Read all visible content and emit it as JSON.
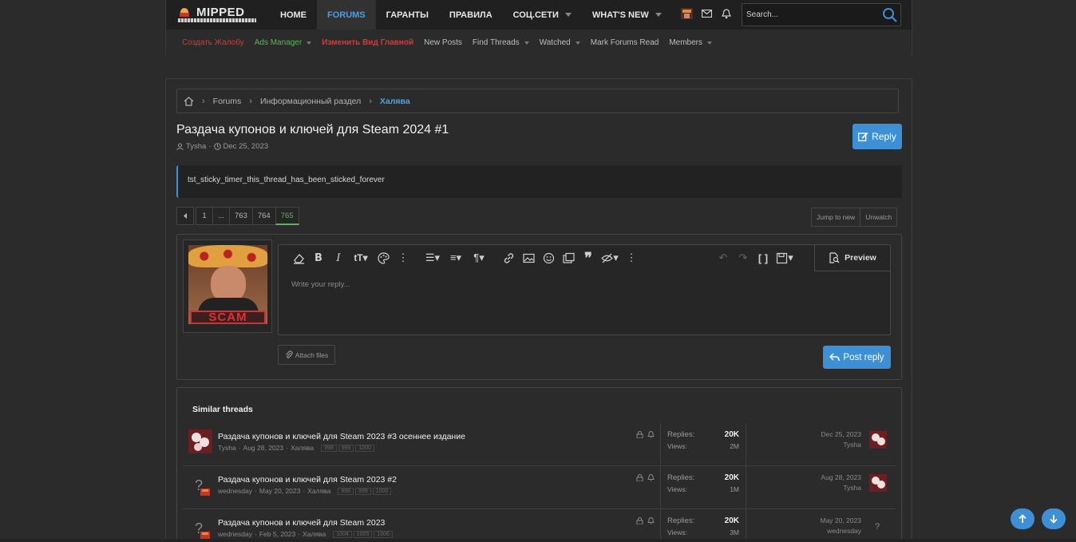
{
  "header": {
    "logo_text": "MIPPED",
    "nav": [
      {
        "label": "HOME",
        "active": false,
        "caret": false
      },
      {
        "label": "FORUMS",
        "active": true,
        "caret": false
      },
      {
        "label": "ГАРАНТЫ",
        "active": false,
        "caret": false
      },
      {
        "label": "ПРАВИЛА",
        "active": false,
        "caret": false
      },
      {
        "label": "СОЦ.СЕТИ",
        "active": false,
        "caret": true
      },
      {
        "label": "WHAT'S NEW",
        "active": false,
        "caret": true
      }
    ],
    "search_placeholder": "Search..."
  },
  "subnav": [
    {
      "label": "Создать Жалобу",
      "color": "#d23a3a",
      "caret": false
    },
    {
      "label": "Ads Manager",
      "color": "#4bbf4b",
      "caret": true
    },
    {
      "label": "Изменить Вид Главной",
      "color": "#e03535",
      "caret": false
    },
    {
      "label": "New Posts",
      "color": "#bdbdbd",
      "caret": false
    },
    {
      "label": "Find Threads",
      "color": "#bdbdbd",
      "caret": true
    },
    {
      "label": "Watched",
      "color": "#bdbdbd",
      "caret": true
    },
    {
      "label": "Mark Forums Read",
      "color": "#bdbdbd",
      "caret": false
    },
    {
      "label": "Members",
      "color": "#bdbdbd",
      "caret": true
    }
  ],
  "breadcrumbs": [
    "Forums",
    "Информационный раздел",
    "Халява"
  ],
  "thread": {
    "title": "Раздача купонов и ключей для Steam 2024 #1",
    "author": "Tysha",
    "date": "Dec 25, 2023",
    "reply_label": "Reply",
    "notice": "tst_sticky_timer_this_thread_has_been_sticked_forever"
  },
  "pager": {
    "pages": [
      "1",
      "...",
      "763",
      "764",
      "765"
    ],
    "current": "765"
  },
  "thread_buttons": {
    "jump": "Jump to new",
    "unwatch": "Unwatch"
  },
  "editor": {
    "placeholder": "Write your reply...",
    "preview_label": "Preview",
    "attach_label": "Attach files",
    "post_label": "Post reply",
    "avatar_caption": "SCAM"
  },
  "similar": {
    "heading": "Similar threads",
    "rows": [
      {
        "title": "Раздача купонов и ключей для Steam 2023 #3 осеннее издание",
        "author": "Tysha",
        "date": "Aug 28, 2023",
        "forum": "Халява",
        "pages": [
          "998",
          "999",
          "1000"
        ],
        "replies_label": "Replies:",
        "replies": "20K",
        "views_label": "Views:",
        "views": "2M",
        "last_date": "Dec 25, 2023",
        "last_user": "Tysha"
      },
      {
        "title": "Раздача купонов и ключей для Steam 2023 #2",
        "author": "wednesday",
        "date": "May 20, 2023",
        "forum": "Халява",
        "pages": [
          "998",
          "999",
          "1000"
        ],
        "replies_label": "Replies:",
        "replies": "20K",
        "views_label": "Views:",
        "views": "1M",
        "last_date": "Aug 28, 2023",
        "last_user": "Tysha"
      },
      {
        "title": "Раздача купонов и ключей для Steam 2023",
        "author": "wednesday",
        "date": "Feb 5, 2023",
        "forum": "Халява",
        "pages": [
          "1004",
          "1005",
          "1006"
        ],
        "replies_label": "Replies:",
        "replies": "20K",
        "views_label": "Views:",
        "views": "3M",
        "last_date": "May 20, 2023",
        "last_user": "wednesday"
      }
    ]
  },
  "colors": {
    "accent": "#3d8fd6",
    "current_page": "#61b061",
    "background": "#2b2b2b"
  }
}
